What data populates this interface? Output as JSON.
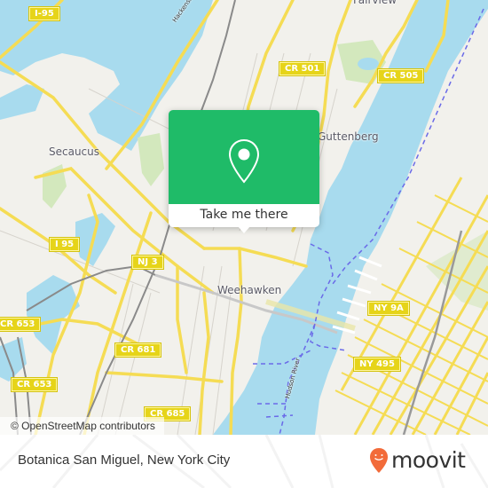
{
  "map": {
    "colors": {
      "land": "#f2f1ec",
      "water": "#a8dbee",
      "road": "#f5dc54",
      "park": "#d3e8bd",
      "ferry": "#6a6ae8",
      "rail": "#888888"
    },
    "place_labels": {
      "fairview": "Fairview",
      "secaucus": "Secaucus",
      "guttenberg": "Guttenberg",
      "weehawken": "Weehawken"
    },
    "river_labels": {
      "hackensack": "Hackensack",
      "hudson": "Hudson River"
    },
    "road_shields": {
      "i95_north": "I-95",
      "cr501": "CR 501",
      "cr505": "CR 505",
      "i95_south": "I 95",
      "nj3": "NJ 3",
      "cr653_upper": "CR 653",
      "cr653_lower": "CR 653",
      "cr681": "CR 681",
      "cr685": "CR 685",
      "ny9a": "NY 9A",
      "ny495": "NY 495"
    },
    "attribution": "© OpenStreetMap contributors"
  },
  "popup": {
    "action_label": "Take me there",
    "icon": "map-pin-icon",
    "color": "#1fbb68"
  },
  "footer": {
    "place_name": "Botanica San Miguel, New York City",
    "logo_text": "moovit",
    "logo_color": "#f26b3a"
  }
}
